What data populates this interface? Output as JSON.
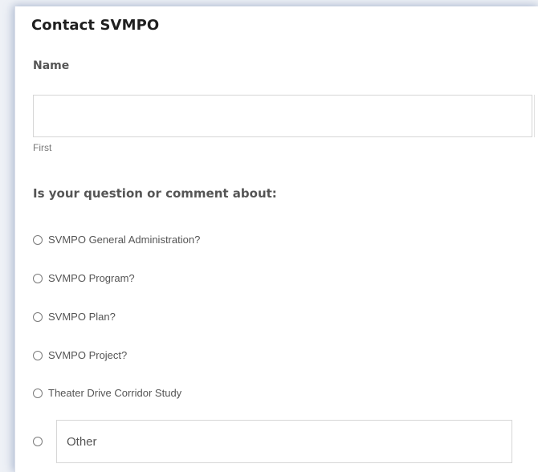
{
  "form": {
    "title": "Contact SVMPO",
    "name_label": "Name",
    "name_value": "",
    "name_sublabel": "First",
    "question": "Is your question or comment about:",
    "options": [
      {
        "label": "SVMPO General Administration?",
        "selected": false
      },
      {
        "label": "SVMPO Program?",
        "selected": false
      },
      {
        "label": "SVMPO Plan?",
        "selected": false
      },
      {
        "label": "SVMPO Project?",
        "selected": false
      },
      {
        "label": "Theater Drive Corridor Study",
        "selected": false
      }
    ],
    "other_placeholder": "Other",
    "other_value": ""
  }
}
